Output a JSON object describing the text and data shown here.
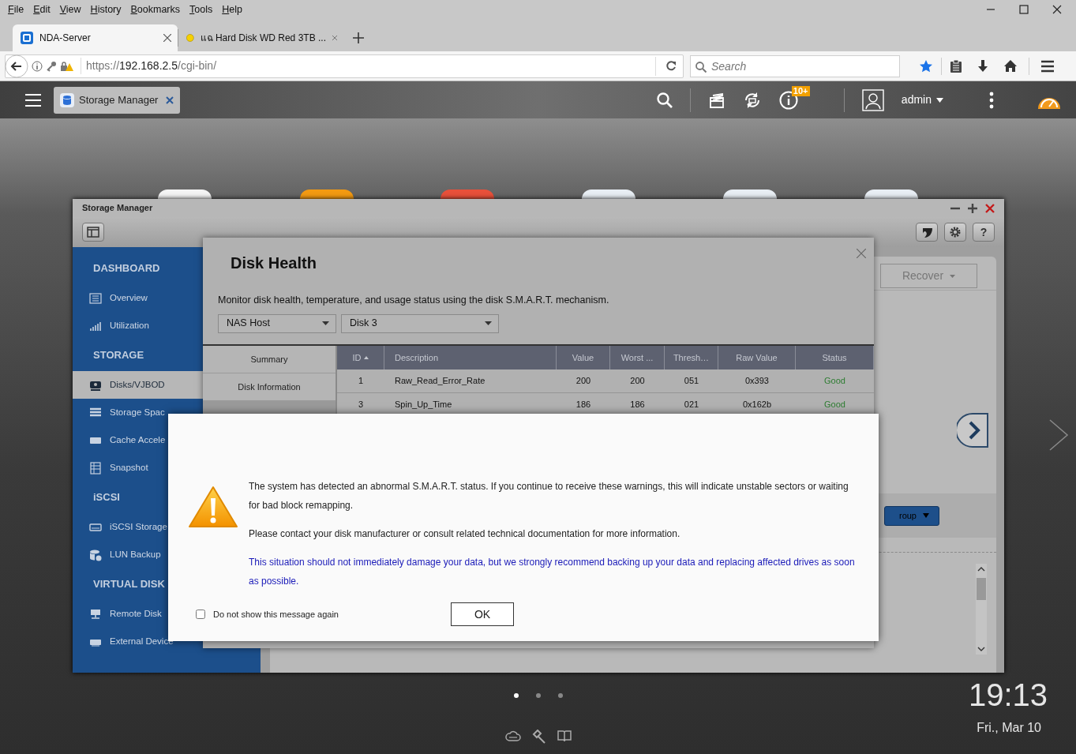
{
  "browser": {
    "menu": [
      "File",
      "Edit",
      "View",
      "History",
      "Bookmarks",
      "Tools",
      "Help"
    ],
    "tabs": [
      {
        "label": "NDA-Server",
        "selected": true
      },
      {
        "label": "แฉ Hard Disk WD Red 3TB ...",
        "selected": false
      }
    ],
    "url": {
      "scheme": "https://",
      "host": "192.168.2.5",
      "path": "/cgi-bin/"
    },
    "search": {
      "placeholder": "Search"
    }
  },
  "nas_bar": {
    "app_tab": "Storage Manager",
    "notification_badge": "10+",
    "user": "admin"
  },
  "storage_manager": {
    "title": "Storage Manager",
    "help_button": "?",
    "sidebar": [
      {
        "kind": "heading",
        "label": "DASHBOARD"
      },
      {
        "kind": "item",
        "label": "Overview",
        "selected": false
      },
      {
        "kind": "item",
        "label": "Utilization",
        "selected": false
      },
      {
        "kind": "heading",
        "label": "STORAGE"
      },
      {
        "kind": "item",
        "label": "Disks/VJBOD",
        "selected": true
      },
      {
        "kind": "item",
        "label": "Storage Spac",
        "selected": false
      },
      {
        "kind": "item",
        "label": "Cache Accele",
        "selected": false
      },
      {
        "kind": "item",
        "label": "Snapshot",
        "selected": false
      },
      {
        "kind": "heading",
        "label": "iSCSI"
      },
      {
        "kind": "item",
        "label": "iSCSI Storage",
        "selected": false
      },
      {
        "kind": "item",
        "label": "LUN Backup",
        "selected": false
      },
      {
        "kind": "heading",
        "label": "VIRTUAL DISK"
      },
      {
        "kind": "item",
        "label": "Remote Disk",
        "selected": false
      },
      {
        "kind": "item",
        "label": "External Device",
        "selected": false
      }
    ],
    "recover_button": "Recover",
    "group_button": "roup"
  },
  "disk_health": {
    "title": "Disk Health",
    "description": "Monitor disk health, temperature, and usage status using the disk S.M.A.R.T. mechanism.",
    "selects": [
      "NAS Host",
      "Disk 3"
    ],
    "nav": [
      {
        "label": "Summary",
        "selected": false
      },
      {
        "label": "Disk Information",
        "selected": false
      }
    ],
    "table": {
      "columns": [
        {
          "label": "ID",
          "sorted": true
        },
        {
          "label": "Description",
          "sorted": false
        },
        {
          "label": "Value",
          "sorted": false
        },
        {
          "label": "Worst ...",
          "sorted": false
        },
        {
          "label": "Thresh…",
          "sorted": false
        },
        {
          "label": "Raw Value",
          "sorted": false
        },
        {
          "label": "Status",
          "sorted": false
        }
      ],
      "rows": [
        [
          "1",
          "Raw_Read_Error_Rate",
          "200",
          "200",
          "051",
          "0x393",
          "Good"
        ],
        [
          "3",
          "Spin_Up_Time",
          "186",
          "186",
          "021",
          "0x162b",
          "Good"
        ]
      ]
    }
  },
  "alert": {
    "paragraphs": [
      {
        "kind": "normal",
        "text": "The system has detected an abnormal S.M.A.R.T. status. If you continue to receive these warnings, this will indicate unstable sectors or waiting for bad block remapping."
      },
      {
        "kind": "normal",
        "text": "Please contact your disk manufacturer or consult related technical documentation for more information."
      },
      {
        "kind": "note",
        "text": "This situation should not immediately damage your data, but we strongly recommend backing up your data and replacing affected drives as soon as possible."
      }
    ],
    "checkbox": {
      "label": "Do not show this message again",
      "checked": false
    },
    "ok_button": "OK"
  },
  "desktop": {
    "pages": [
      {
        "selected": true
      },
      {
        "selected": false
      },
      {
        "selected": false
      }
    ],
    "time": "19:13",
    "date": "Fri., Mar 10"
  }
}
